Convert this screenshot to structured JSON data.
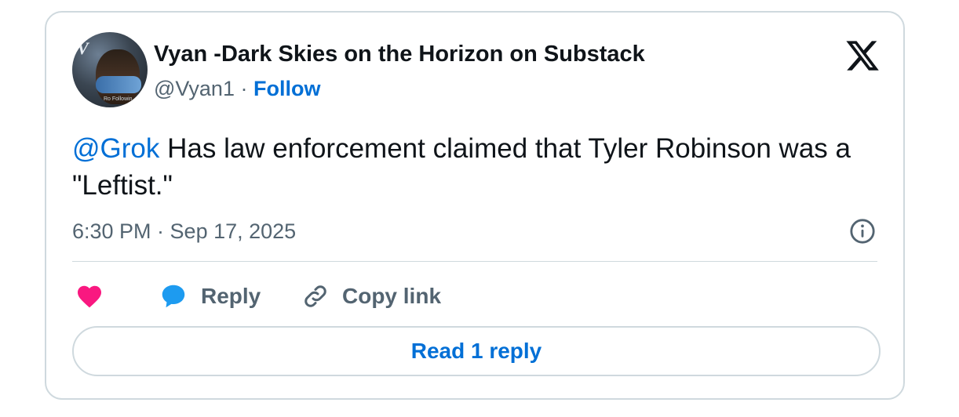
{
  "author": {
    "name": "Vyan -Dark Skies on the Horizon on Substack",
    "handle": "@Vyan1",
    "separator": "·",
    "follow_label": "Follow",
    "avatar_letter": "V",
    "avatar_caption": "Ro Followin"
  },
  "tweet": {
    "mention": "@Grok",
    "text": " Has law enforcement claimed that Tyler Robinson was a \"Leftist.\"",
    "timestamp": "6:30 PM · Sep 17, 2025"
  },
  "actions": {
    "reply_label": "Reply",
    "copy_label": "Copy link"
  },
  "read_replies_label": "Read 1 reply",
  "colors": {
    "link_blue": "#006fd6",
    "heart_pink": "#f91880",
    "reply_blue": "#1d9bf0",
    "muted": "#536471",
    "border": "#cfd9de"
  },
  "icons": [
    "x-logo-icon",
    "info-icon",
    "heart-icon",
    "reply-bubble-icon",
    "link-icon"
  ]
}
